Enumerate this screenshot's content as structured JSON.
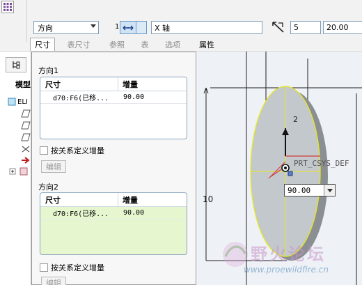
{
  "toolbar": {
    "direction_type": "方向",
    "direction_index": "1",
    "reference": "X 轴",
    "count": "5",
    "increment": "20.00"
  },
  "tabs": [
    {
      "label": "尺寸",
      "active": true
    },
    {
      "label": "表尺寸",
      "active": false
    },
    {
      "label": "参照",
      "active": false
    },
    {
      "label": "表",
      "active": false
    },
    {
      "label": "选项",
      "active": false
    },
    {
      "label": "属性",
      "active": false
    }
  ],
  "model_tree": {
    "title": "模型",
    "root": "ELI"
  },
  "panel": {
    "direction1": {
      "label": "方向1",
      "columns": [
        "尺寸",
        "增量"
      ],
      "rows": [
        {
          "dimension": "d70:F6(已移...",
          "increment": "90.00"
        }
      ],
      "checkbox": "按关系定义增量",
      "edit_button": "编辑"
    },
    "direction2": {
      "label": "方向2",
      "columns": [
        "尺寸",
        "增量"
      ],
      "rows": [
        {
          "dimension": "d70:F6(已移...",
          "increment": "90.00"
        }
      ],
      "checkbox": "按关系定义增量",
      "edit_button": "编辑"
    }
  },
  "graphics": {
    "csys_label": "PRT_CSYS_DEF",
    "dim_value": "90.00",
    "dim_10": "10",
    "dim_2": "2",
    "highlight_color": "#e8e817",
    "dim_color": "#e03a3a"
  },
  "watermark": {
    "title": "野火论坛",
    "url": "www.proewildfire.cn"
  }
}
